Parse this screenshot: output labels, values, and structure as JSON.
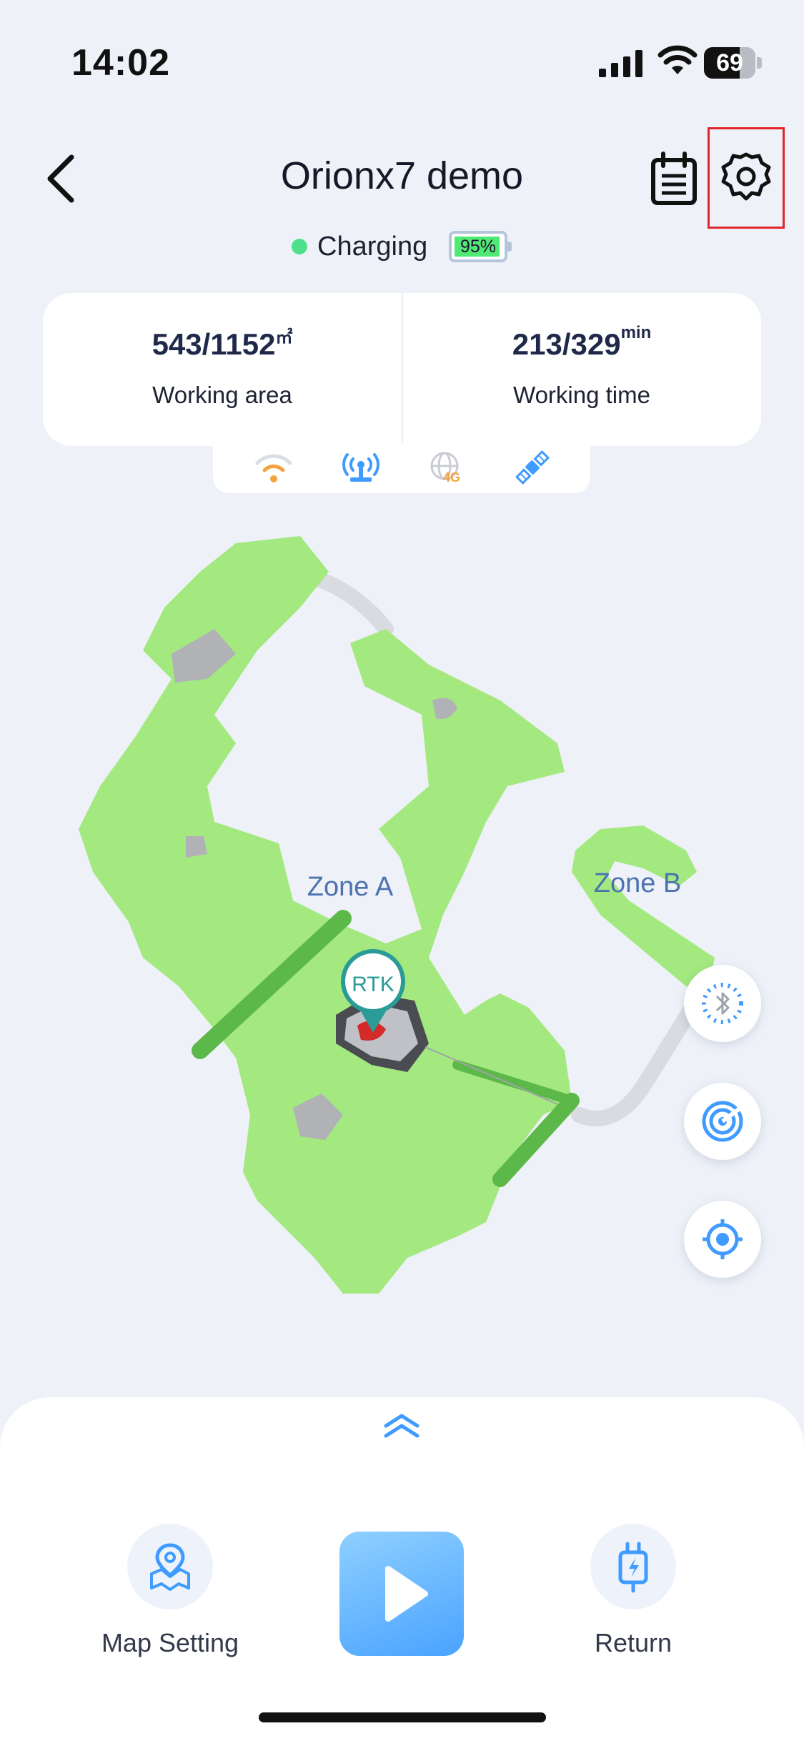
{
  "status_bar": {
    "time": "14:02",
    "battery": "69",
    "battery_level": 0.69
  },
  "header": {
    "title": "Orionx7 demo",
    "back_icon": "chevron-left-icon",
    "calendar_icon": "schedule-icon",
    "settings_icon": "gear-icon"
  },
  "status": {
    "charging_label": "Charging",
    "battery_percent": "95%",
    "battery_level": 0.95,
    "dot_color": "#4ee08b"
  },
  "stats": {
    "area": {
      "value": "543/1152",
      "unit": "㎡",
      "label": "Working area"
    },
    "time": {
      "value": "213/329",
      "unit": "min",
      "label": "Working time"
    }
  },
  "indicators": [
    "wifi-icon",
    "rtk-antenna-icon",
    "4g-globe-icon",
    "satellite-icon"
  ],
  "map": {
    "zone_a": "Zone A",
    "zone_b": "Zone B",
    "rtk_label": "RTK",
    "lawn_color": "#a3e97f",
    "stripe_color": "#5db84a"
  },
  "fab": [
    "bluetooth-icon",
    "radar-icon",
    "locate-icon"
  ],
  "bottom": {
    "map_setting_label": "Map Setting",
    "return_label": "Return",
    "accent": "#3f9bff"
  }
}
